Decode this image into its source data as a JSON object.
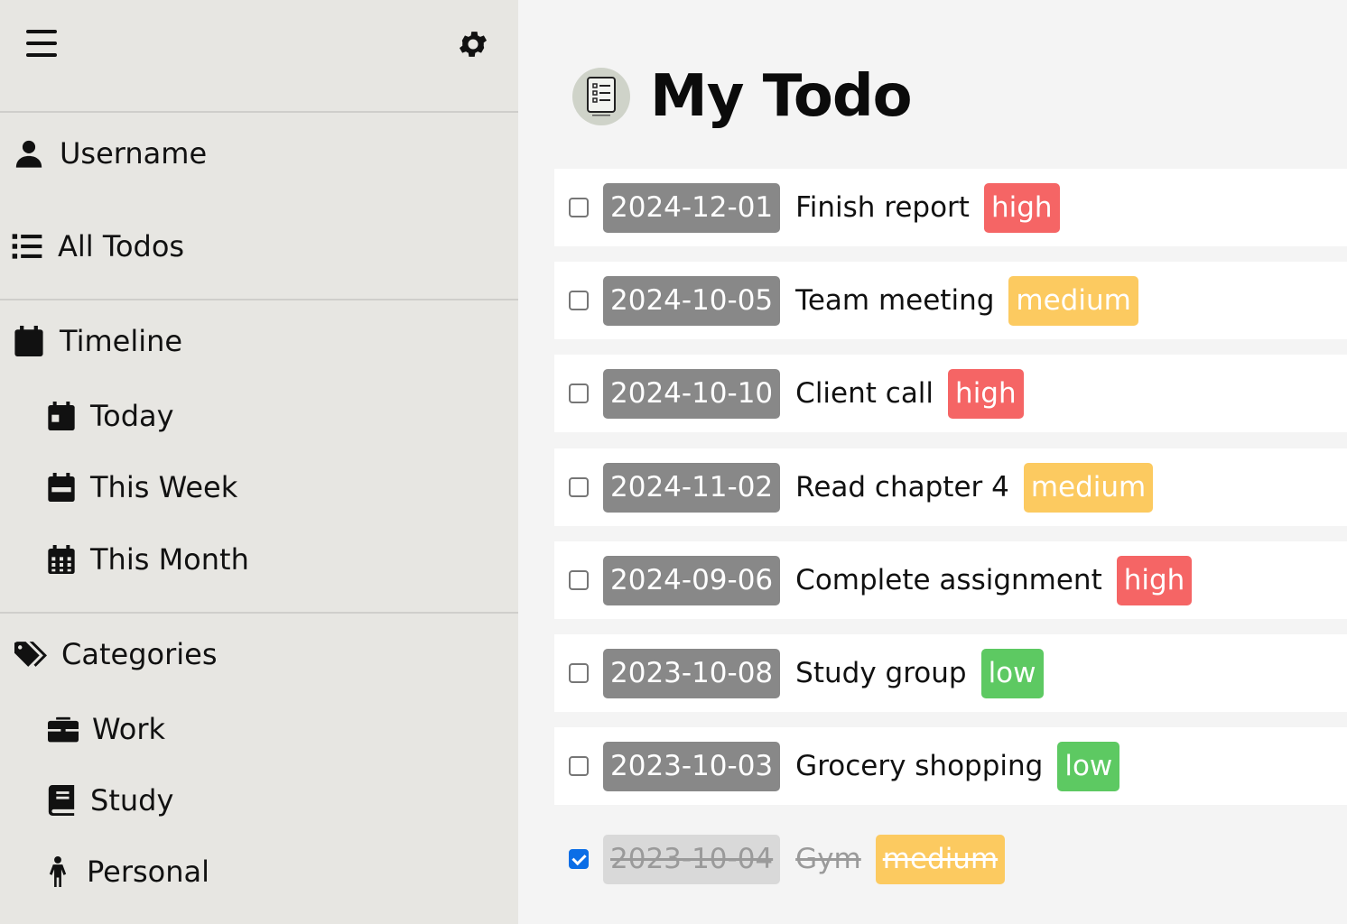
{
  "sidebar": {
    "menu_icon": "hamburger-icon",
    "settings_icon": "gear-icon",
    "user": {
      "label": "Username",
      "icon": "user-icon"
    },
    "all_todos": {
      "label": "All Todos",
      "icon": "list-icon"
    },
    "timeline": {
      "label": "Timeline",
      "icon": "calendar-icon",
      "items": [
        {
          "label": "Today",
          "icon": "calendar-day-icon"
        },
        {
          "label": "This Week",
          "icon": "calendar-week-icon"
        },
        {
          "label": "This Month",
          "icon": "calendar-month-icon"
        }
      ]
    },
    "categories": {
      "label": "Categories",
      "icon": "tags-icon",
      "items": [
        {
          "label": "Work",
          "icon": "briefcase-icon"
        },
        {
          "label": "Study",
          "icon": "book-icon"
        },
        {
          "label": "Personal",
          "icon": "person-icon"
        }
      ]
    }
  },
  "main": {
    "title": "My Todo",
    "logo_icon": "notepad-icon"
  },
  "colors": {
    "high": "#f56565",
    "medium": "#fcca60",
    "low": "#5dc962",
    "date_badge": "#888888",
    "checkbox_checked": "#0b6ee6"
  },
  "todos": [
    {
      "date": "2024-12-01",
      "text": "Finish report",
      "priority": "high",
      "done": false
    },
    {
      "date": "2024-10-05",
      "text": "Team meeting",
      "priority": "medium",
      "done": false
    },
    {
      "date": "2024-10-10",
      "text": "Client call",
      "priority": "high",
      "done": false
    },
    {
      "date": "2024-11-02",
      "text": "Read chapter 4",
      "priority": "medium",
      "done": false
    },
    {
      "date": "2024-09-06",
      "text": "Complete assignment",
      "priority": "high",
      "done": false
    },
    {
      "date": "2023-10-08",
      "text": "Study group",
      "priority": "low",
      "done": false
    },
    {
      "date": "2023-10-03",
      "text": "Grocery shopping",
      "priority": "low",
      "done": false
    },
    {
      "date": "2023-10-04",
      "text": "Gym",
      "priority": "medium",
      "done": true
    }
  ]
}
